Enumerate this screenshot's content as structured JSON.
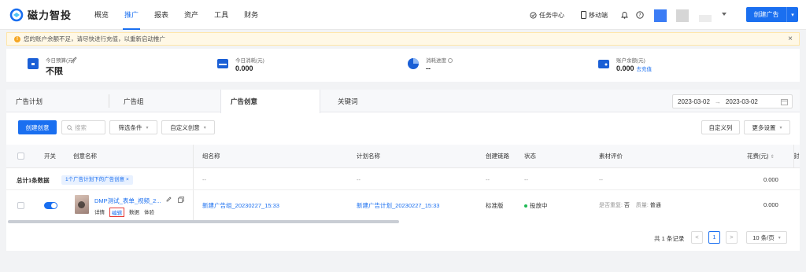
{
  "brand": {
    "name": "磁力智投"
  },
  "nav": [
    {
      "label": "概览"
    },
    {
      "label": "推广"
    },
    {
      "label": "报表"
    },
    {
      "label": "资产"
    },
    {
      "label": "工具"
    },
    {
      "label": "财务"
    }
  ],
  "header": {
    "task_center": "任务中心",
    "mobile": "移动端",
    "create_button": "创建广告",
    "accent": "#1a6ff0"
  },
  "notice": {
    "text": "您的账户余额不足，请尽快进行充值，以重新启动推广"
  },
  "stats": {
    "budget": {
      "label": "今日预算(元)",
      "value": "不限"
    },
    "spend": {
      "label": "今日消耗(元)",
      "value": "0.000"
    },
    "progress": {
      "label": "消耗进度",
      "value": "--"
    },
    "balance": {
      "label": "账户余额(元)",
      "value": "0.000",
      "link": "去充值"
    }
  },
  "tabs": [
    {
      "label": "广告计划"
    },
    {
      "label": "广告组"
    },
    {
      "label": "广告创意"
    },
    {
      "label": "关键词"
    }
  ],
  "date_range": {
    "start": "2023-03-02",
    "end": "2023-03-02",
    "arrow": "→"
  },
  "toolbar": {
    "create_label": "创建创意",
    "search_placeholder": "搜索",
    "filter_label": "筛选条件",
    "custom_creative_label": "自定义创意",
    "custom_columns_label": "自定义列",
    "more_settings_label": "更多设置"
  },
  "table": {
    "columns": {
      "switch": "开关",
      "creative_name": "创意名称",
      "group_name": "组名称",
      "plan_name": "计划名称",
      "link": "创建链路",
      "status": "状态",
      "material": "素材评价",
      "cost": "花费(元)",
      "extra": "封"
    },
    "summary": {
      "label": "总计1条数据",
      "chip": "1个广告计划下的广告创意",
      "group": "--",
      "plan": "--",
      "link": "--",
      "status": "--",
      "material": "--",
      "cost": "0.000"
    },
    "row": {
      "creative_name": "DMP测试_表单_视频_2...",
      "actions": [
        "详情",
        "编辑",
        "数据",
        "体验"
      ],
      "group": "新建广告组_20230227_15:33",
      "plan": "新建广告计划_20230227_15:33",
      "link": "标准版",
      "status": "投放中",
      "material_repeat_label": "是否重复:",
      "material_repeat_value": "否",
      "material_quality_label": "质量:",
      "material_quality_value": "普通",
      "cost": "0.000"
    }
  },
  "pagination": {
    "total": "共 1 条记录",
    "prev": "<",
    "page": "1",
    "next": ">",
    "page_size": "10 条/页"
  }
}
